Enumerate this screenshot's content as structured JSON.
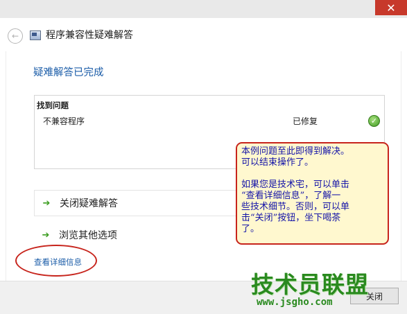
{
  "titlebar": {
    "close_glyph": "✕"
  },
  "nav": {
    "back_glyph": "←",
    "title": "程序兼容性疑难解答"
  },
  "main": {
    "heading": "疑难解答已完成",
    "problems": {
      "header": "找到问题",
      "rows": [
        {
          "name": "不兼容程序",
          "status": "已修复",
          "status_icon": "check-icon"
        }
      ]
    },
    "options": [
      {
        "label": "关闭疑难解答",
        "icon": "arrow-right-icon"
      },
      {
        "label": "浏览其他选项",
        "icon": "arrow-right-icon"
      }
    ],
    "details_link": "查看详细信息"
  },
  "footer": {
    "close_label": "关闭"
  },
  "callout": {
    "line1": "本例问题至此即得到解决。",
    "line2": "可以结束操作了。",
    "line3": "如果您是技术宅，可以单击",
    "line4": "“查看详细信息”，了解一",
    "line5": "些技术细节。否则，可以单",
    "line6": "击“关闭”按钮，坐下喝茶",
    "line7": "了。"
  },
  "watermark": {
    "text": "技术员联盟",
    "url": "www.jsgho.com"
  },
  "colors": {
    "heading": "#1d5ea9",
    "link": "#1d5ea9",
    "accent_green": "#3a9c1f",
    "callout_border": "#c7241c",
    "callout_text": "#1414a8",
    "close_button": "#c7392b"
  }
}
